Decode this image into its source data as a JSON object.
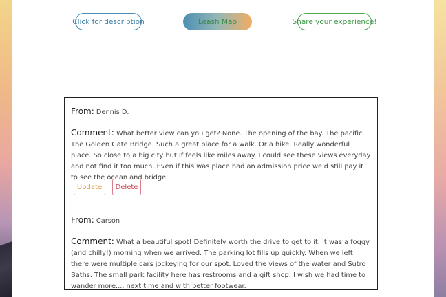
{
  "nav": {
    "description_label": "Click for description",
    "map_label": "Leash Map",
    "share_label": "Share your experience!"
  },
  "reviews": [
    {
      "from_label": "From:",
      "author": "Dennis D.",
      "comment_label": "Comment:",
      "comment": "What better view can you get? None. The opening of the bay. The pacific. The Golden Gate Bridge. Such a great place for a walk. Or a hike. Really wonderful place. So close to a big city but If feels like miles away. I could see these views everyday and not find it too much. Even if this was place had an admission price we'd still pay it to see the ocean and bridge.",
      "update_label": "Update",
      "delete_label": "Delete"
    },
    {
      "from_label": "From:",
      "author": "Carson",
      "comment_label": "Comment:",
      "comment": "What a beautiful spot! Definitely worth the drive to get to it. It was a foggy (and chilly!) morning when we arrived. The parking lot fills up quickly. When we left there were multiple cars jockeying for our spot. Loved the views of the water and Sutro Baths. The small park facility here has restrooms and a gift shop. I wish we had time to wander more.... next time and with better footwear."
    }
  ]
}
